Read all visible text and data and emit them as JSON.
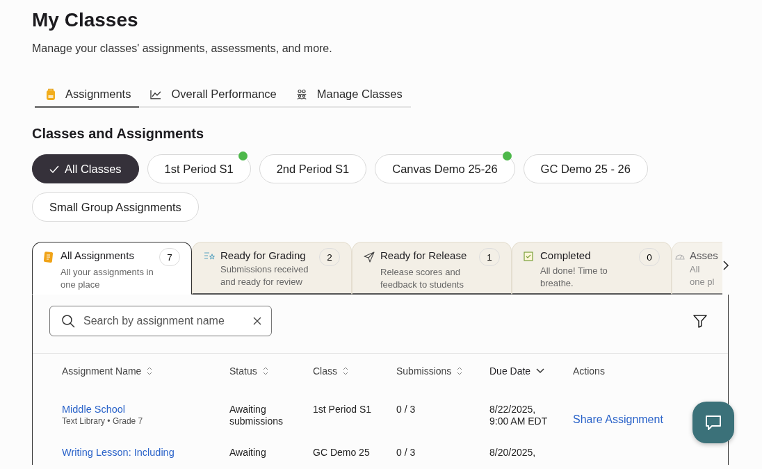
{
  "page": {
    "title": "My Classes",
    "subtitle": "Manage your classes' assignments, assessments, and more."
  },
  "nav_tabs": [
    {
      "label": "Assignments",
      "selected": true,
      "kind": "backpack"
    },
    {
      "label": "Overall Performance",
      "selected": false,
      "kind": "chart"
    },
    {
      "label": "Manage Classes",
      "selected": false,
      "kind": "people"
    }
  ],
  "section_title": "Classes and Assignments",
  "class_filters": [
    {
      "label": "All Classes",
      "selected": true,
      "has_update": false
    },
    {
      "label": "1st Period S1",
      "selected": false,
      "has_update": true
    },
    {
      "label": "2nd Period S1",
      "selected": false,
      "has_update": false
    },
    {
      "label": "Canvas Demo 25-26",
      "selected": false,
      "has_update": true
    },
    {
      "label": "GC Demo 25 - 26",
      "selected": false,
      "has_update": false
    },
    {
      "label": "Small Group Assignments",
      "selected": false,
      "has_update": false
    }
  ],
  "assignment_tabs": [
    {
      "kind": "all",
      "title": "All Assignments",
      "description": [
        "All your assignments in",
        "one place"
      ],
      "count": "7",
      "selected": true
    },
    {
      "kind": "grading",
      "title": "Ready for Grading",
      "description": [
        "Submissions received",
        "and ready for review"
      ],
      "count": "2",
      "selected": false
    },
    {
      "kind": "release",
      "title": "Ready for Release",
      "description": [
        "Release scores and",
        "feedback to students"
      ],
      "count": "1",
      "selected": false
    },
    {
      "kind": "completed",
      "title": "Completed",
      "description": [
        "All done! Time to",
        "breathe."
      ],
      "count": "0",
      "selected": false
    },
    {
      "kind": "assessments",
      "title": "Asses",
      "description": [
        "All",
        "one pl"
      ],
      "selected": false
    }
  ],
  "search": {
    "placeholder": "Search by assignment name"
  },
  "table": {
    "columns": [
      {
        "label": "Assignment Name",
        "sortable": true,
        "sorted": false
      },
      {
        "label": "Status",
        "sortable": true,
        "sorted": false
      },
      {
        "label": "Class",
        "sortable": true,
        "sorted": false
      },
      {
        "label": "Submissions",
        "sortable": true,
        "sorted": false
      },
      {
        "label": "Due Date",
        "sortable": true,
        "sorted": true
      },
      {
        "label": "Actions",
        "sortable": false,
        "sorted": false
      }
    ],
    "rows": [
      {
        "name": "Middle School",
        "details": "Text Library • Grade 7",
        "status": "Awaiting submissions",
        "class": "1st Period S1",
        "submissions": "0 / 3",
        "due": "8/22/2025, 9:00 AM EDT",
        "action": "Share Assignment"
      },
      {
        "name": "Writing Lesson: Including",
        "status": "Awaiting",
        "class": "GC Demo 25",
        "submissions": "0 / 3",
        "due": "8/20/2025,"
      }
    ]
  }
}
